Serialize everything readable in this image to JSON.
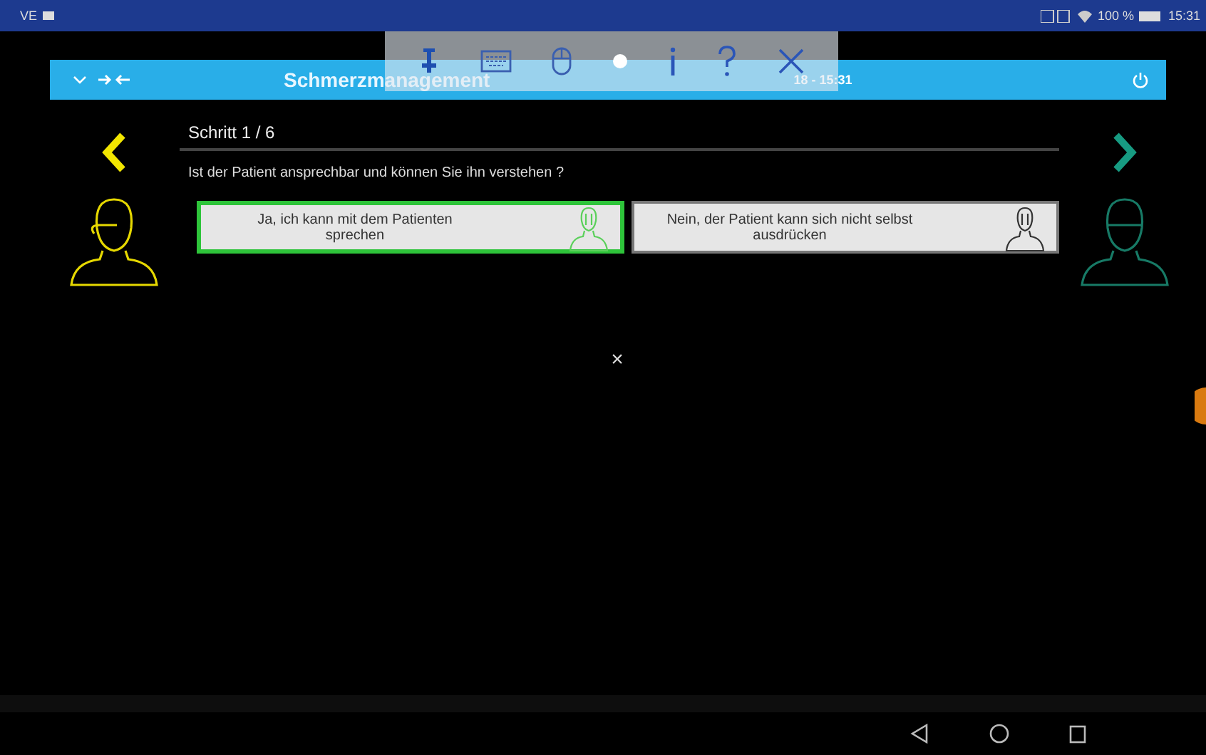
{
  "status_bar": {
    "left_text": "VE",
    "battery": "100 %",
    "time": "15:31"
  },
  "header": {
    "title": "Schmerzmanagement",
    "datetime": "18 - 15:31"
  },
  "step": {
    "label": "Schritt 1 / 6",
    "question": "Ist der Patient ansprechbar und können Sie ihn verstehen ?"
  },
  "options": [
    {
      "label": "Ja, ich kann mit dem Patienten sprechen",
      "selected": true
    },
    {
      "label": "Nein, der Patient kann sich nicht selbst ausdrücken",
      "selected": false
    }
  ],
  "close_mark": "×"
}
